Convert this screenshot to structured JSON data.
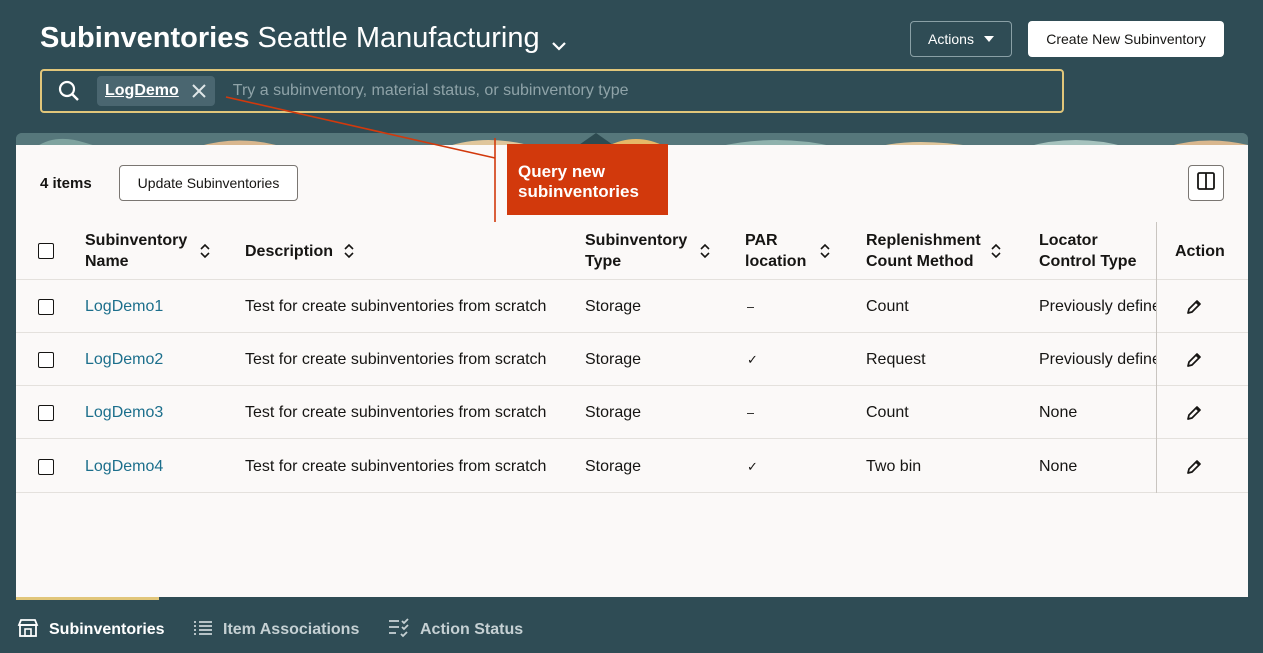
{
  "header": {
    "title_bold": "Subinventories",
    "title_org": "Seattle Manufacturing",
    "actions_label": "Actions",
    "create_label": "Create New Subinventory"
  },
  "search": {
    "chip": "LogDemo",
    "placeholder": "Try a subinventory, material status, or subinventory type"
  },
  "toolbar": {
    "count": "4 items",
    "update_label": "Update Subinventories"
  },
  "table": {
    "columns": [
      "Subinventory Name",
      "Description",
      "Subinventory Type",
      "PAR location",
      "Replenishment Count Method",
      "Locator Control Type",
      "Action"
    ],
    "rows": [
      {
        "name": "LogDemo1",
        "description": "Test for create subinventories from scratch",
        "type": "Storage",
        "par": "–",
        "method": "Count",
        "locator": "Previously defined"
      },
      {
        "name": "LogDemo2",
        "description": "Test for create subinventories from scratch",
        "type": "Storage",
        "par": "✓",
        "method": "Request",
        "locator": "Previously defined"
      },
      {
        "name": "LogDemo3",
        "description": "Test for create subinventories from scratch",
        "type": "Storage",
        "par": "–",
        "method": "Count",
        "locator": "None"
      },
      {
        "name": "LogDemo4",
        "description": "Test for create subinventories from scratch",
        "type": "Storage",
        "par": "✓",
        "method": "Two bin",
        "locator": "None"
      }
    ]
  },
  "callout": {
    "text": "Query new subinventories"
  },
  "bottom_tabs": [
    {
      "label": "Subinventories",
      "icon": "store-icon",
      "active": true
    },
    {
      "label": "Item Associations",
      "icon": "list-icon",
      "active": false
    },
    {
      "label": "Action Status",
      "icon": "checklist-icon",
      "active": false
    }
  ],
  "colors": {
    "header_bg": "#2f4c55",
    "accent": "#e1c67a",
    "link": "#1c6f8c",
    "callout": "#d2390c"
  }
}
